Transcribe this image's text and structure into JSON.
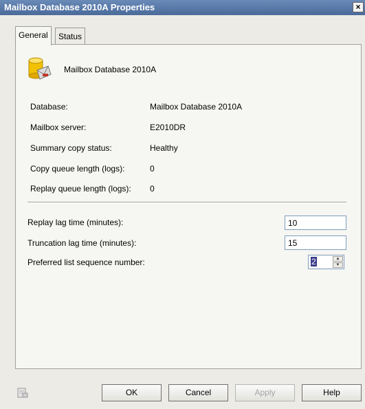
{
  "window": {
    "title": "Mailbox Database 2010A Properties",
    "close": "×"
  },
  "tabs": [
    {
      "label": "General",
      "active": true
    },
    {
      "label": "Status",
      "active": false
    }
  ],
  "header": {
    "icon": "database-icon",
    "name": "Mailbox Database 2010A"
  },
  "info": [
    {
      "label": "Database:",
      "value": "Mailbox Database 2010A"
    },
    {
      "label": "Mailbox server:",
      "value": "E2010DR"
    },
    {
      "label": "Summary copy status:",
      "value": "Healthy"
    },
    {
      "label": "Copy queue length (logs):",
      "value": "0"
    },
    {
      "label": "Replay queue length (logs):",
      "value": "0"
    }
  ],
  "settings": {
    "replay_lag": {
      "label": "Replay lag time (minutes):",
      "value": "10"
    },
    "truncation_lag": {
      "label": "Truncation lag time (minutes):",
      "value": "15"
    },
    "preferred_sequence": {
      "label": "Preferred list sequence number:",
      "value": "2"
    }
  },
  "buttons": {
    "ok": "OK",
    "cancel": "Cancel",
    "apply": "Apply",
    "help": "Help"
  },
  "colors": {
    "titlebar": "#5a7aa8",
    "dialog": "#ecebe6",
    "selection": "#3a3a8a"
  }
}
